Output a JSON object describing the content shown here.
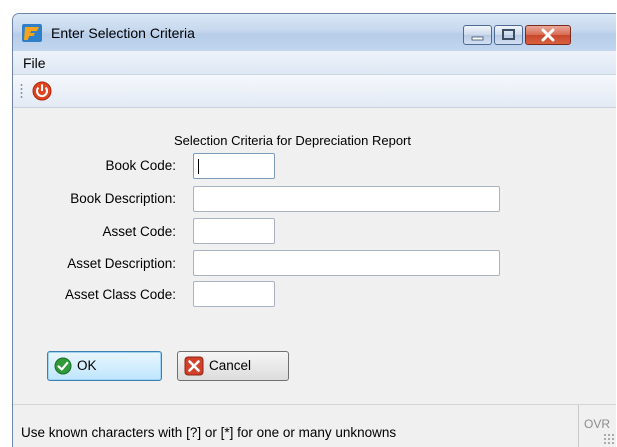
{
  "window": {
    "title": "Enter Selection Criteria"
  },
  "titlebar_icons": {
    "app": "app-icon",
    "minimize": "minimize-icon",
    "maximize": "maximize-icon",
    "close": "close-icon"
  },
  "menu": {
    "file": "File"
  },
  "toolbar": {
    "exit_icon": "power-icon"
  },
  "form": {
    "title": "Selection Criteria for Depreciation Report",
    "fields": [
      {
        "label": "Book Code:",
        "value": ""
      },
      {
        "label": "Book Description:",
        "value": ""
      },
      {
        "label": "Asset Code:",
        "value": ""
      },
      {
        "label": "Asset Description:",
        "value": ""
      },
      {
        "label": "Asset Class Code:",
        "value": ""
      }
    ]
  },
  "buttons": {
    "ok": "OK",
    "cancel": "Cancel"
  },
  "status": {
    "hint": "Use known characters with [?] or [*] for one or many unknowns",
    "mode": "OVR"
  },
  "colors": {
    "ok_icon": "#2e9a3a",
    "cancel_icon": "#d2402a",
    "power_icon": "#e0451f",
    "titlebar": "#c6d8ee"
  }
}
